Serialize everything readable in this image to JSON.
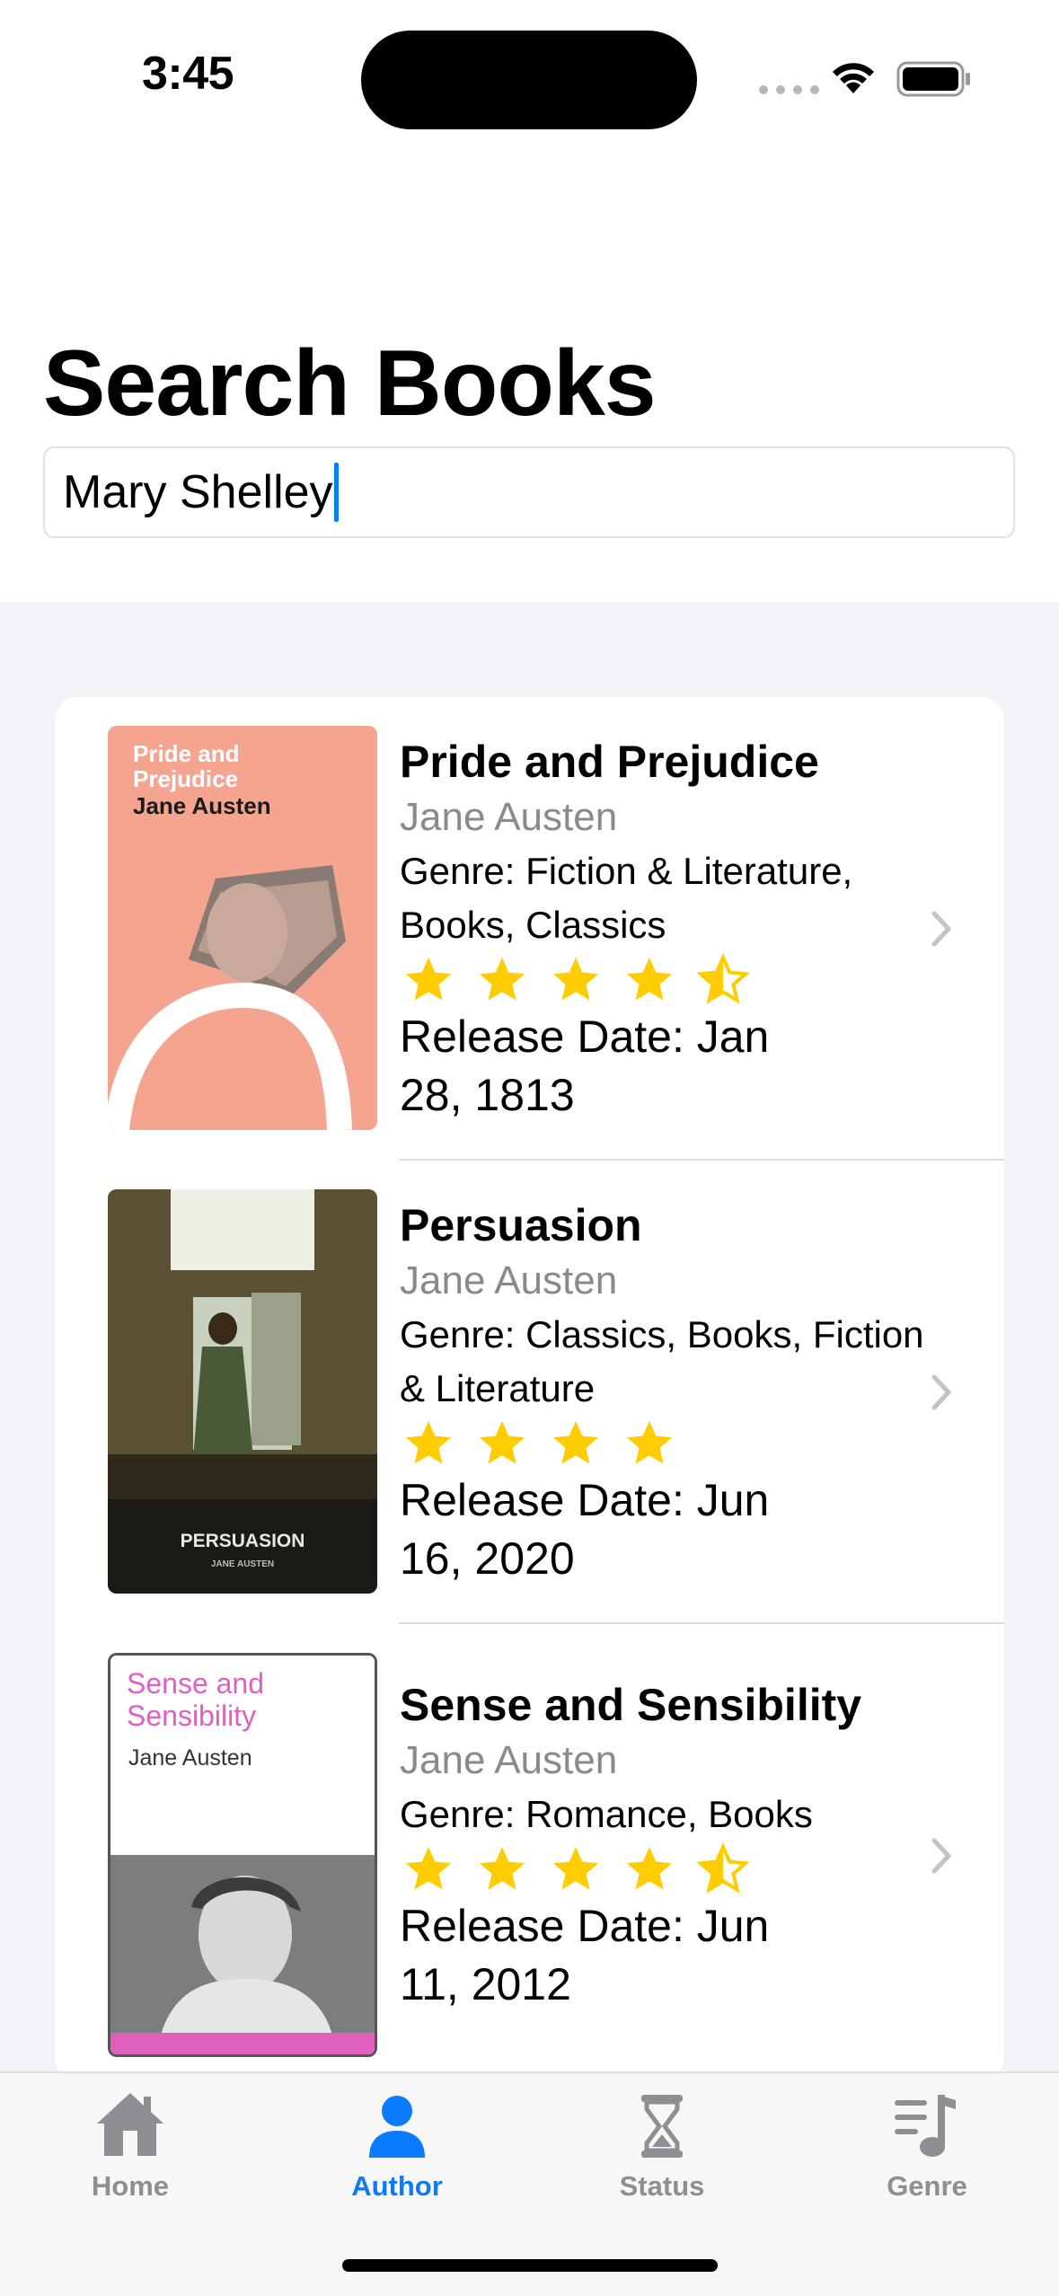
{
  "status_bar": {
    "time": "3:45"
  },
  "page": {
    "title": "Search Books"
  },
  "search": {
    "value": "Mary Shelley",
    "cursor_color": "#0a7aff"
  },
  "books": [
    {
      "title": "Pride and Prejudice",
      "author": "Jane Austen",
      "genre": "Genre: Fiction & Literature, Books, Classics",
      "rating": 4.5,
      "release": "Release Date: Jan 28, 1813",
      "cover": {
        "title_text": "Pride and Prejudice",
        "author_text": "Jane Austen",
        "background": "#f5a58f"
      }
    },
    {
      "title": "Persuasion",
      "author": "Jane Austen",
      "genre": "Genre: Classics, Books, Fiction & Literature",
      "rating": 4,
      "release": "Release Date: Jun 16, 2020",
      "cover": {
        "title_text": "PERSUASION",
        "author_text": "JANE AUSTEN",
        "background": "#4a4530"
      }
    },
    {
      "title": "Sense and Sensibility",
      "author": "Jane Austen",
      "genre": "Genre: Romance, Books",
      "rating": 4.5,
      "release": "Release Date: Jun 11, 2012",
      "cover": {
        "title_text": "Sense and Sensibility",
        "author_text": "Jane Austen",
        "background": "#ffffff"
      }
    }
  ],
  "tab_bar": {
    "tabs": [
      {
        "label": "Home",
        "icon": "house-icon",
        "active": false
      },
      {
        "label": "Author",
        "icon": "person-icon",
        "active": true
      },
      {
        "label": "Status",
        "icon": "hourglass-icon",
        "active": false
      },
      {
        "label": "Genre",
        "icon": "music-list-icon",
        "active": false
      }
    ],
    "active_color": "#0a7aff",
    "inactive_color": "#8e8e93"
  },
  "colors": {
    "star": "#ffcc00",
    "secondary_text": "#8a8a8e",
    "background": "#f2f2f7"
  }
}
